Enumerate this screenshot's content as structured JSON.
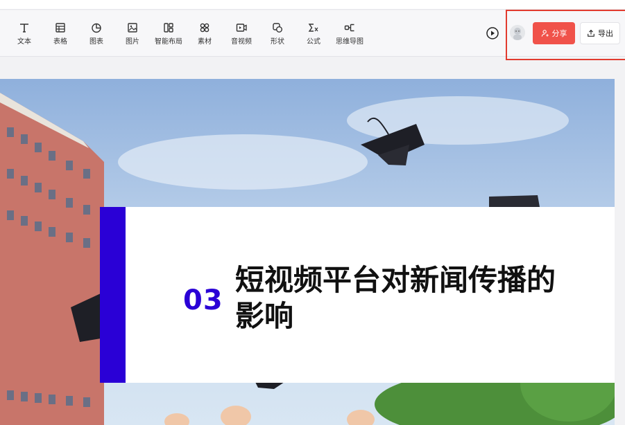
{
  "toolbar": {
    "tools": [
      {
        "label": "文本",
        "icon": "text-icon"
      },
      {
        "label": "表格",
        "icon": "table-icon"
      },
      {
        "label": "图表",
        "icon": "chart-icon"
      },
      {
        "label": "图片",
        "icon": "image-icon"
      },
      {
        "label": "智能布局",
        "icon": "smart-layout-icon"
      },
      {
        "label": "素材",
        "icon": "material-icon"
      },
      {
        "label": "音视频",
        "icon": "video-icon"
      },
      {
        "label": "形状",
        "icon": "shape-icon"
      },
      {
        "label": "公式",
        "icon": "formula-icon"
      },
      {
        "label": "思维导图",
        "icon": "mindmap-icon"
      }
    ],
    "share_label": "分享",
    "export_label": "导出",
    "share_color": "#f0524a"
  },
  "slide": {
    "number": "03",
    "title": "短视频平台对新闻传播的影响",
    "accent_color": "#2a00d6"
  }
}
